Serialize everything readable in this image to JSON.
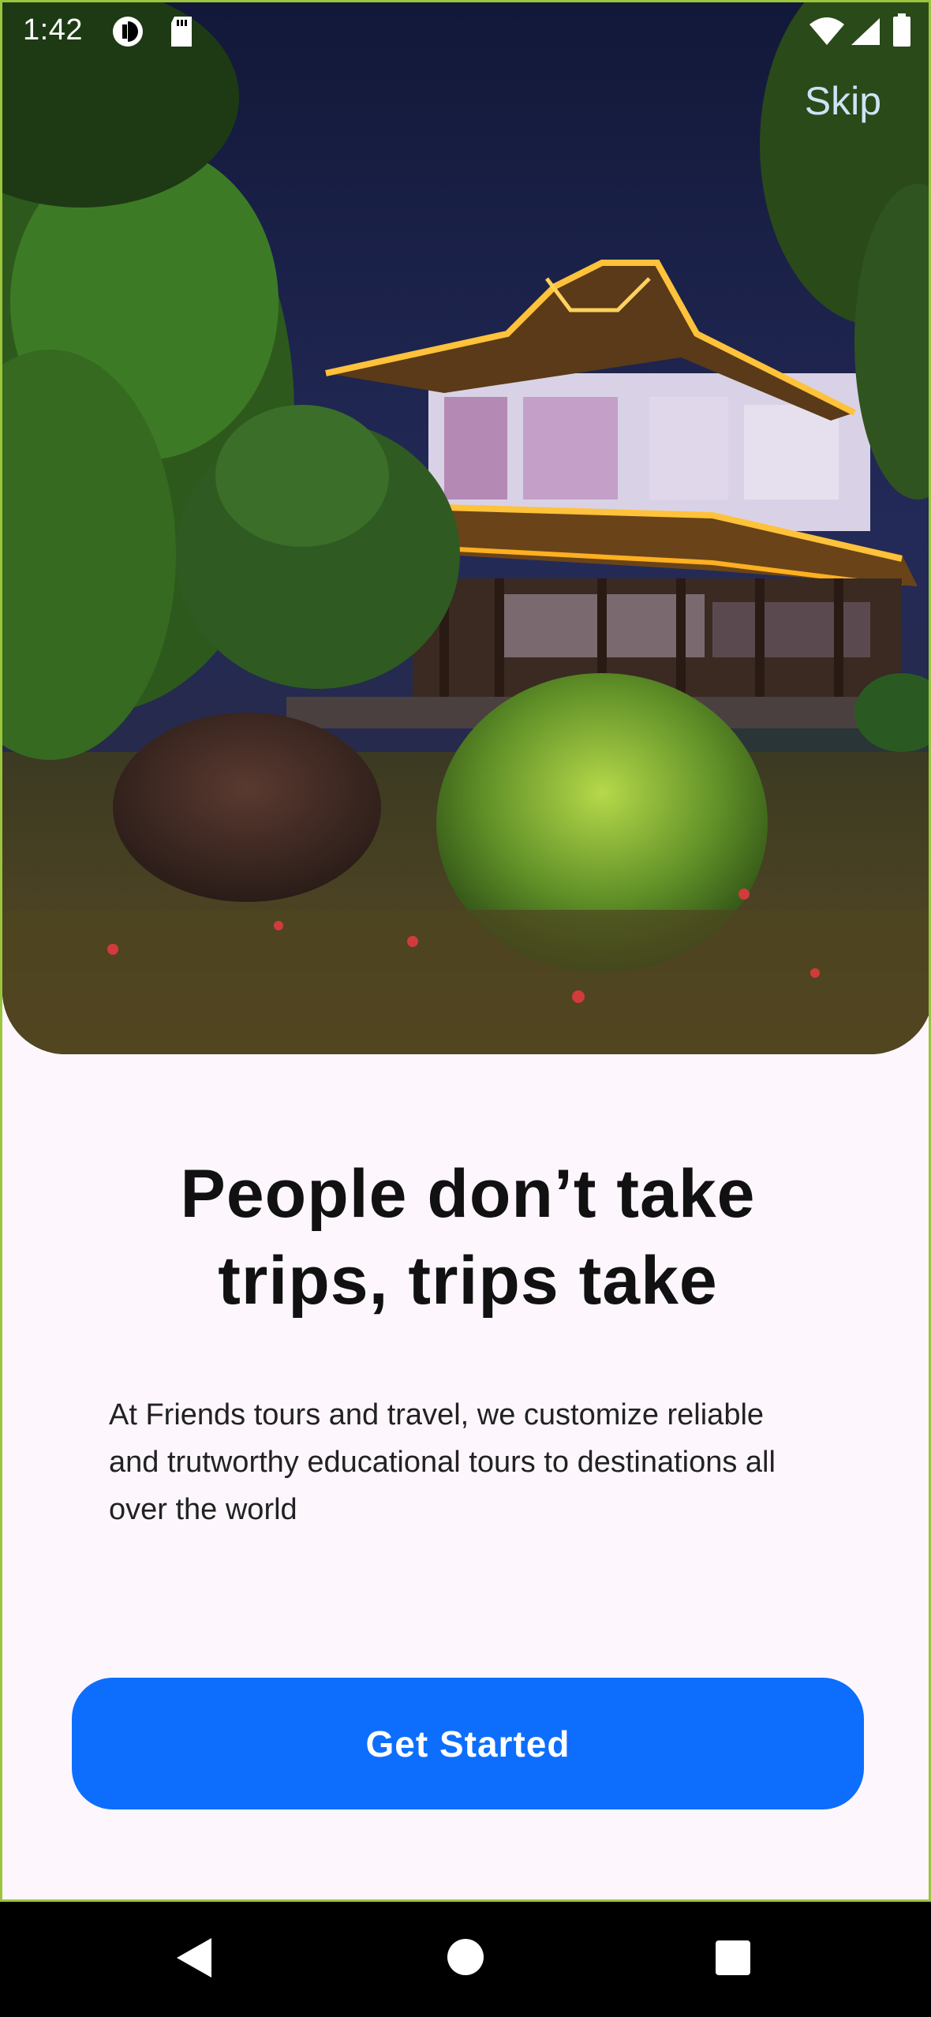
{
  "status_bar": {
    "time": "1:42",
    "icons": [
      "app-notification-icon",
      "sd-card-icon",
      "wifi-icon",
      "cell-signal-icon",
      "battery-icon"
    ]
  },
  "header": {
    "skip_label": "Skip"
  },
  "hero": {
    "image": "illuminated-chinese-pagoda-at-night-with-garden"
  },
  "content": {
    "headline_line1": "People don’t take",
    "headline_line2": "trips, trips take",
    "body": "At Friends tours and travel, we customize reliable and trutworthy educational tours to destinations all over the world"
  },
  "cta": {
    "label": "Get Started",
    "color": "#0d6efd"
  },
  "nav_bar": {
    "buttons": [
      "back-icon",
      "home-icon",
      "recents-icon"
    ]
  },
  "colors": {
    "background": "#fdf7fd",
    "headline": "#111111",
    "skip": "#cfe3f5"
  }
}
